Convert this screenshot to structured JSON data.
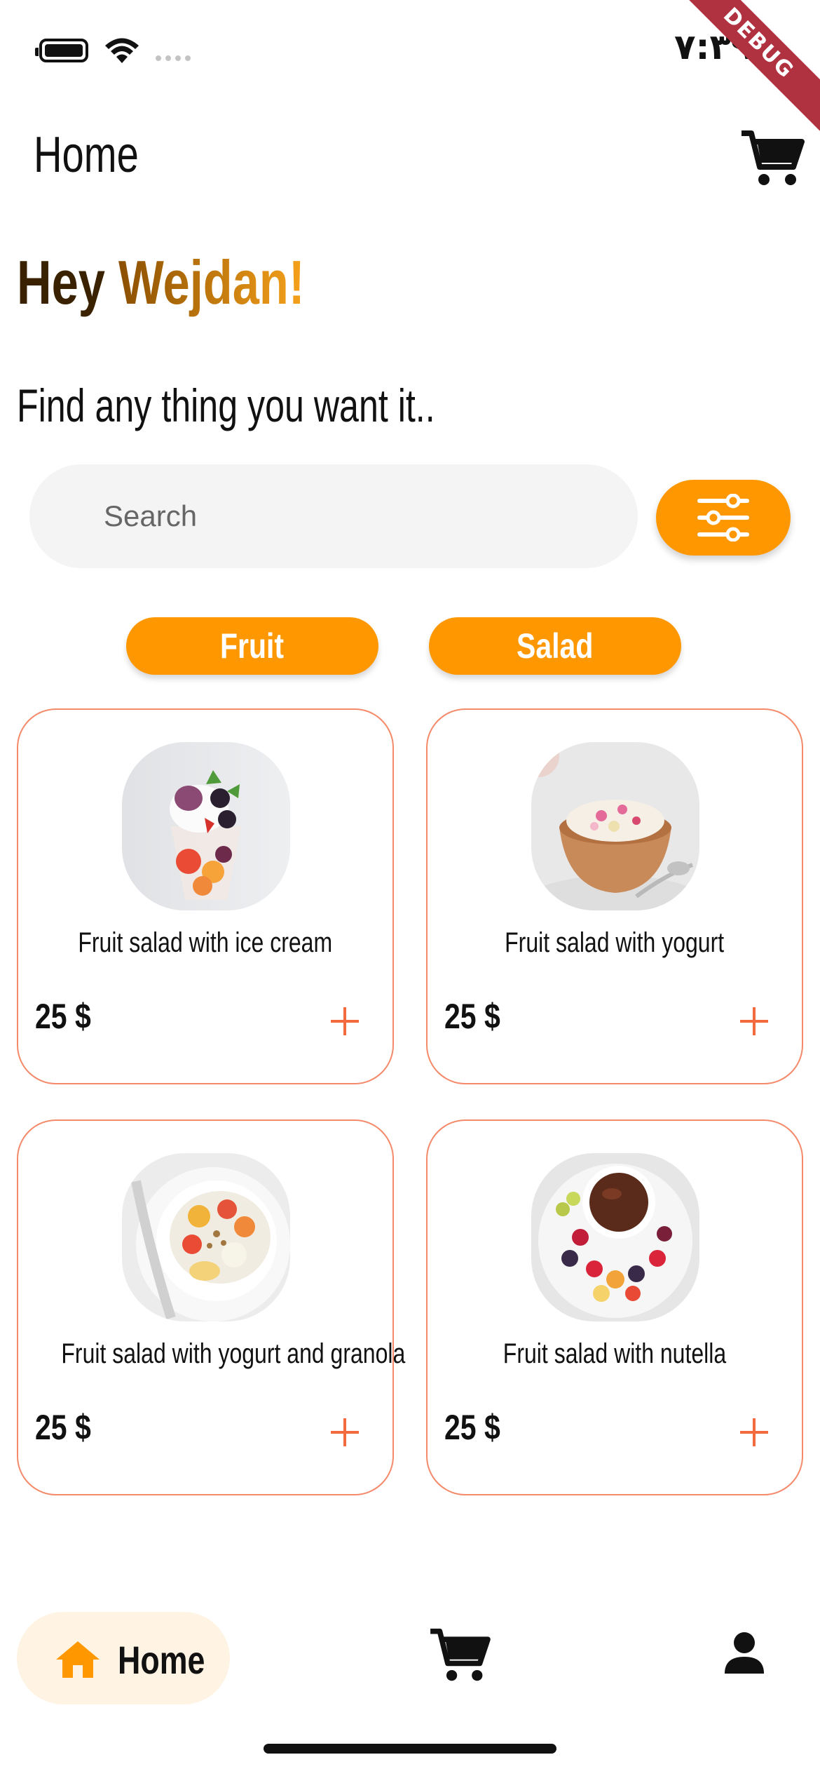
{
  "status_bar": {
    "time": "٧:٣٩",
    "debug_label": "DEBUG"
  },
  "app_bar": {
    "title": "Home"
  },
  "greeting": {
    "prefix": "Hey",
    "name": "Wejdan!"
  },
  "subtitle": "Find any thing you want it..",
  "search": {
    "placeholder": "Search"
  },
  "categories": [
    {
      "label": "Fruit"
    },
    {
      "label": "Salad"
    }
  ],
  "products": [
    {
      "title": "Fruit salad with ice cream",
      "price": "25 $",
      "image": "fruit-ice-cream-cup"
    },
    {
      "title": "Fruit salad with yogurt",
      "price": "25 $",
      "image": "yogurt-fruit-bowl"
    },
    {
      "title": "Fruit salad with yogurt and granola",
      "price": "25 $",
      "image": "granola-fruit-bowl"
    },
    {
      "title": "Fruit salad with nutella",
      "price": "25 $",
      "image": "berries-chocolate-plate"
    }
  ],
  "bottom_nav": {
    "home_label": "Home",
    "icons": [
      "home-icon",
      "cart-icon",
      "profile-icon"
    ]
  },
  "colors": {
    "accent": "#ff9800",
    "card_border": "#f48a6a",
    "add_icon": "#f26a3d",
    "nav_pill": "#fff3e3"
  }
}
